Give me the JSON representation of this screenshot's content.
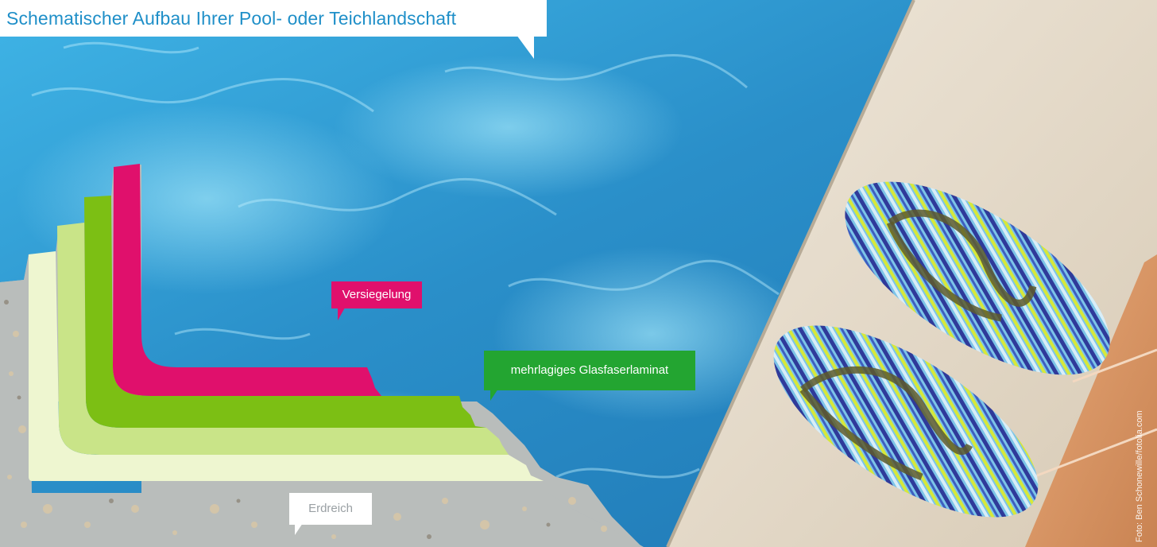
{
  "title": "Schematischer Aufbau Ihrer Pool- oder Teichlandschaft",
  "labels": {
    "sealing": "Versiegelung",
    "laminate": "mehrlagiges Glasfaserlaminat",
    "soil": "Erdreich"
  },
  "photo_credit": "Foto: Ben Schonewille/fotolia.com",
  "colors": {
    "title": "#1f8fc8",
    "sealing": "#e0106c",
    "laminate": "#23a531",
    "layer_green_dark": "#7cbf14",
    "layer_green_mid": "#c9e488",
    "layer_green_light": "#eef6d0",
    "soil": "#b9bdbb",
    "water": "#2f9fd6",
    "deck": "#e9e0d2"
  }
}
